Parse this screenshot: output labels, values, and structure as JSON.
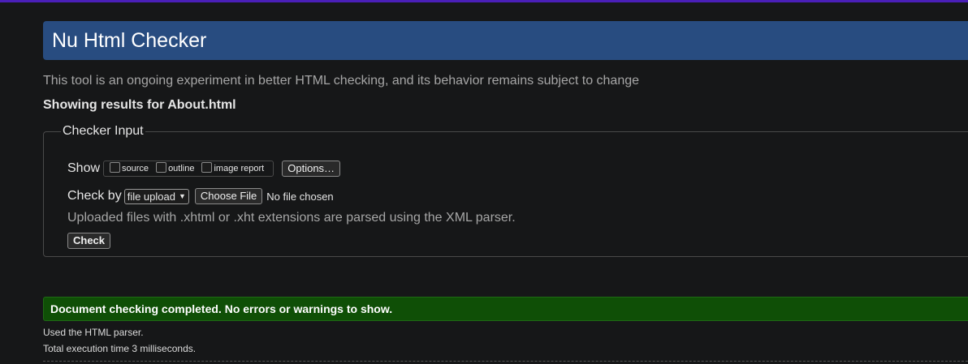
{
  "header": {
    "title": "Nu Html Checker"
  },
  "intro": "This tool is an ongoing experiment in better HTML checking, and its behavior remains subject to change",
  "showing_results": "Showing results for About.html",
  "checker_input": {
    "legend": "Checker Input",
    "show_label": "Show",
    "show_options": [
      {
        "label": "source",
        "checked": false
      },
      {
        "label": "outline",
        "checked": false
      },
      {
        "label": "image report",
        "checked": false
      }
    ],
    "options_button": "Options…",
    "check_by_label": "Check by",
    "check_by_selected": "file upload",
    "choose_file_button": "Choose File",
    "file_status": "No file chosen",
    "note": "Uploaded files with .xhtml or .xht extensions are parsed using the XML parser.",
    "check_button": "Check"
  },
  "result": {
    "message": "Document checking completed. No errors or warnings to show.",
    "parser": "Used the HTML parser.",
    "execution_time": "Total execution time 3 milliseconds."
  },
  "colors": {
    "title_bar": "#284c80",
    "success_bar": "#0f4f06",
    "top_accent": "#4a1fb8"
  }
}
